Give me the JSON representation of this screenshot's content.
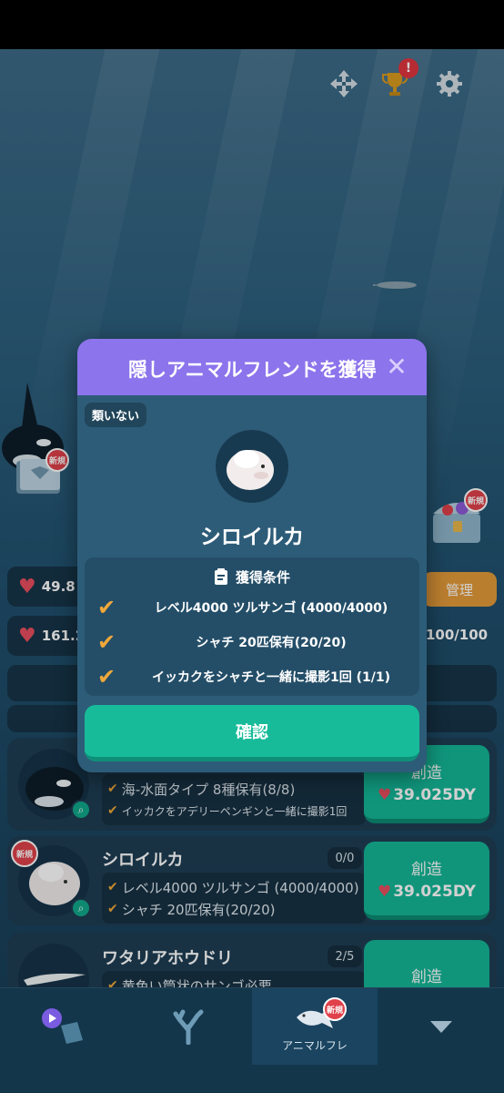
{
  "top_icons": [
    "move-arrows-icon",
    "trophy-icon",
    "settings-gear-icon"
  ],
  "alert_badge": "!",
  "new_tag": "新規",
  "stats": {
    "hearts": "49.8",
    "hearts_per_tap": "161.2",
    "manage_button": "管理",
    "capacity": "100/100"
  },
  "modal": {
    "title": "隠しアニマルフレンドを獲得",
    "close": "✕",
    "rarity": "類いない",
    "animal_name": "シロイルカ",
    "conditions_header": "獲得条件",
    "conditions": [
      "レベル4000 ツルサンゴ (4000/4000)",
      "シャチ 20匹保有(20/20)",
      "イッカクをシャチと一緒に撮影1回 (1/1)"
    ],
    "confirm": "確認"
  },
  "cards": [
    {
      "name": "",
      "progress": "",
      "conditions": [
        "海-水面タイプ 8種保有(8/8)",
        "イッカクをアデリーペンギンと一緒に撮影1回"
      ],
      "button_label": "創造",
      "cost": "39.025DY"
    },
    {
      "name": "シロイルカ",
      "progress": "0/0",
      "conditions": [
        "レベル4000 ツルサンゴ (4000/4000)",
        "シャチ 20匹保有(20/20)"
      ],
      "button_label": "創造",
      "cost": "39.025DY"
    },
    {
      "name": "ワタリアホウドリ",
      "progress": "2/5",
      "conditions": [
        "黄色い筒状のサンゴ必要"
      ],
      "button_label": "創造",
      "cost": ""
    }
  ],
  "bottom_nav": {
    "tabs": [
      {
        "icon": "video-play-icon",
        "label": ""
      },
      {
        "icon": "coral-icon",
        "label": ""
      },
      {
        "icon": "animal-fish-icon",
        "label": "アニマルフレ"
      },
      {
        "icon": "chevron-down-icon",
        "label": ""
      }
    ]
  },
  "colors": {
    "modal_header": "#8c74ec",
    "confirm_button": "#17bb9a",
    "check": "#f0a83a",
    "heart": "#e84d5f"
  }
}
